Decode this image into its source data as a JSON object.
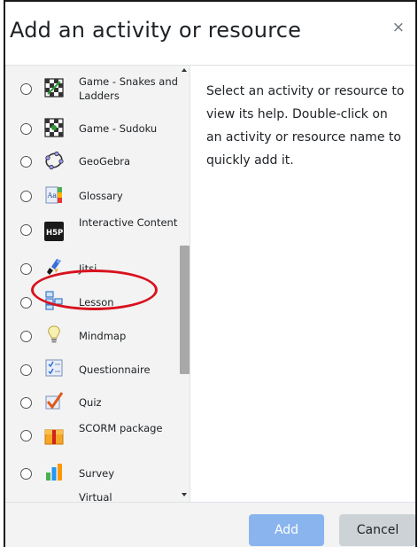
{
  "dialog": {
    "title": "Add an activity or resource",
    "close_symbol": "×",
    "close_icon": "close-icon"
  },
  "modules": [
    {
      "label": "Game - Snakes and Ladders",
      "icon": "snakes-ladders-icon"
    },
    {
      "label": "Game - Sudoku",
      "icon": "sudoku-icon"
    },
    {
      "label": "GeoGebra",
      "icon": "geogebra-icon"
    },
    {
      "label": "Glossary",
      "icon": "glossary-icon"
    },
    {
      "label": "Interactive Content",
      "icon": "h5p-icon"
    },
    {
      "label": "Jitsi",
      "icon": "jitsi-icon"
    },
    {
      "label": "Lesson",
      "icon": "lesson-icon"
    },
    {
      "label": "Mindmap",
      "icon": "mindmap-icon"
    },
    {
      "label": "Questionnaire",
      "icon": "questionnaire-icon"
    },
    {
      "label": "Quiz",
      "icon": "quiz-icon"
    },
    {
      "label": "SCORM package",
      "icon": "scorm-icon"
    },
    {
      "label": "Survey",
      "icon": "survey-icon"
    },
    {
      "label": "Virtual",
      "icon": "virtual-classroom-icon"
    }
  ],
  "help_text": "Select an activity or resource to view its help. Double-click on an activity or resource name to quickly add it.",
  "footer": {
    "add_label": "Add",
    "cancel_label": "Cancel"
  },
  "colors": {
    "add_button": "#8ab4ee",
    "cancel_button": "#cdd2d6",
    "highlight_ring": "#d8121e",
    "list_background": "#f3f3f3"
  }
}
